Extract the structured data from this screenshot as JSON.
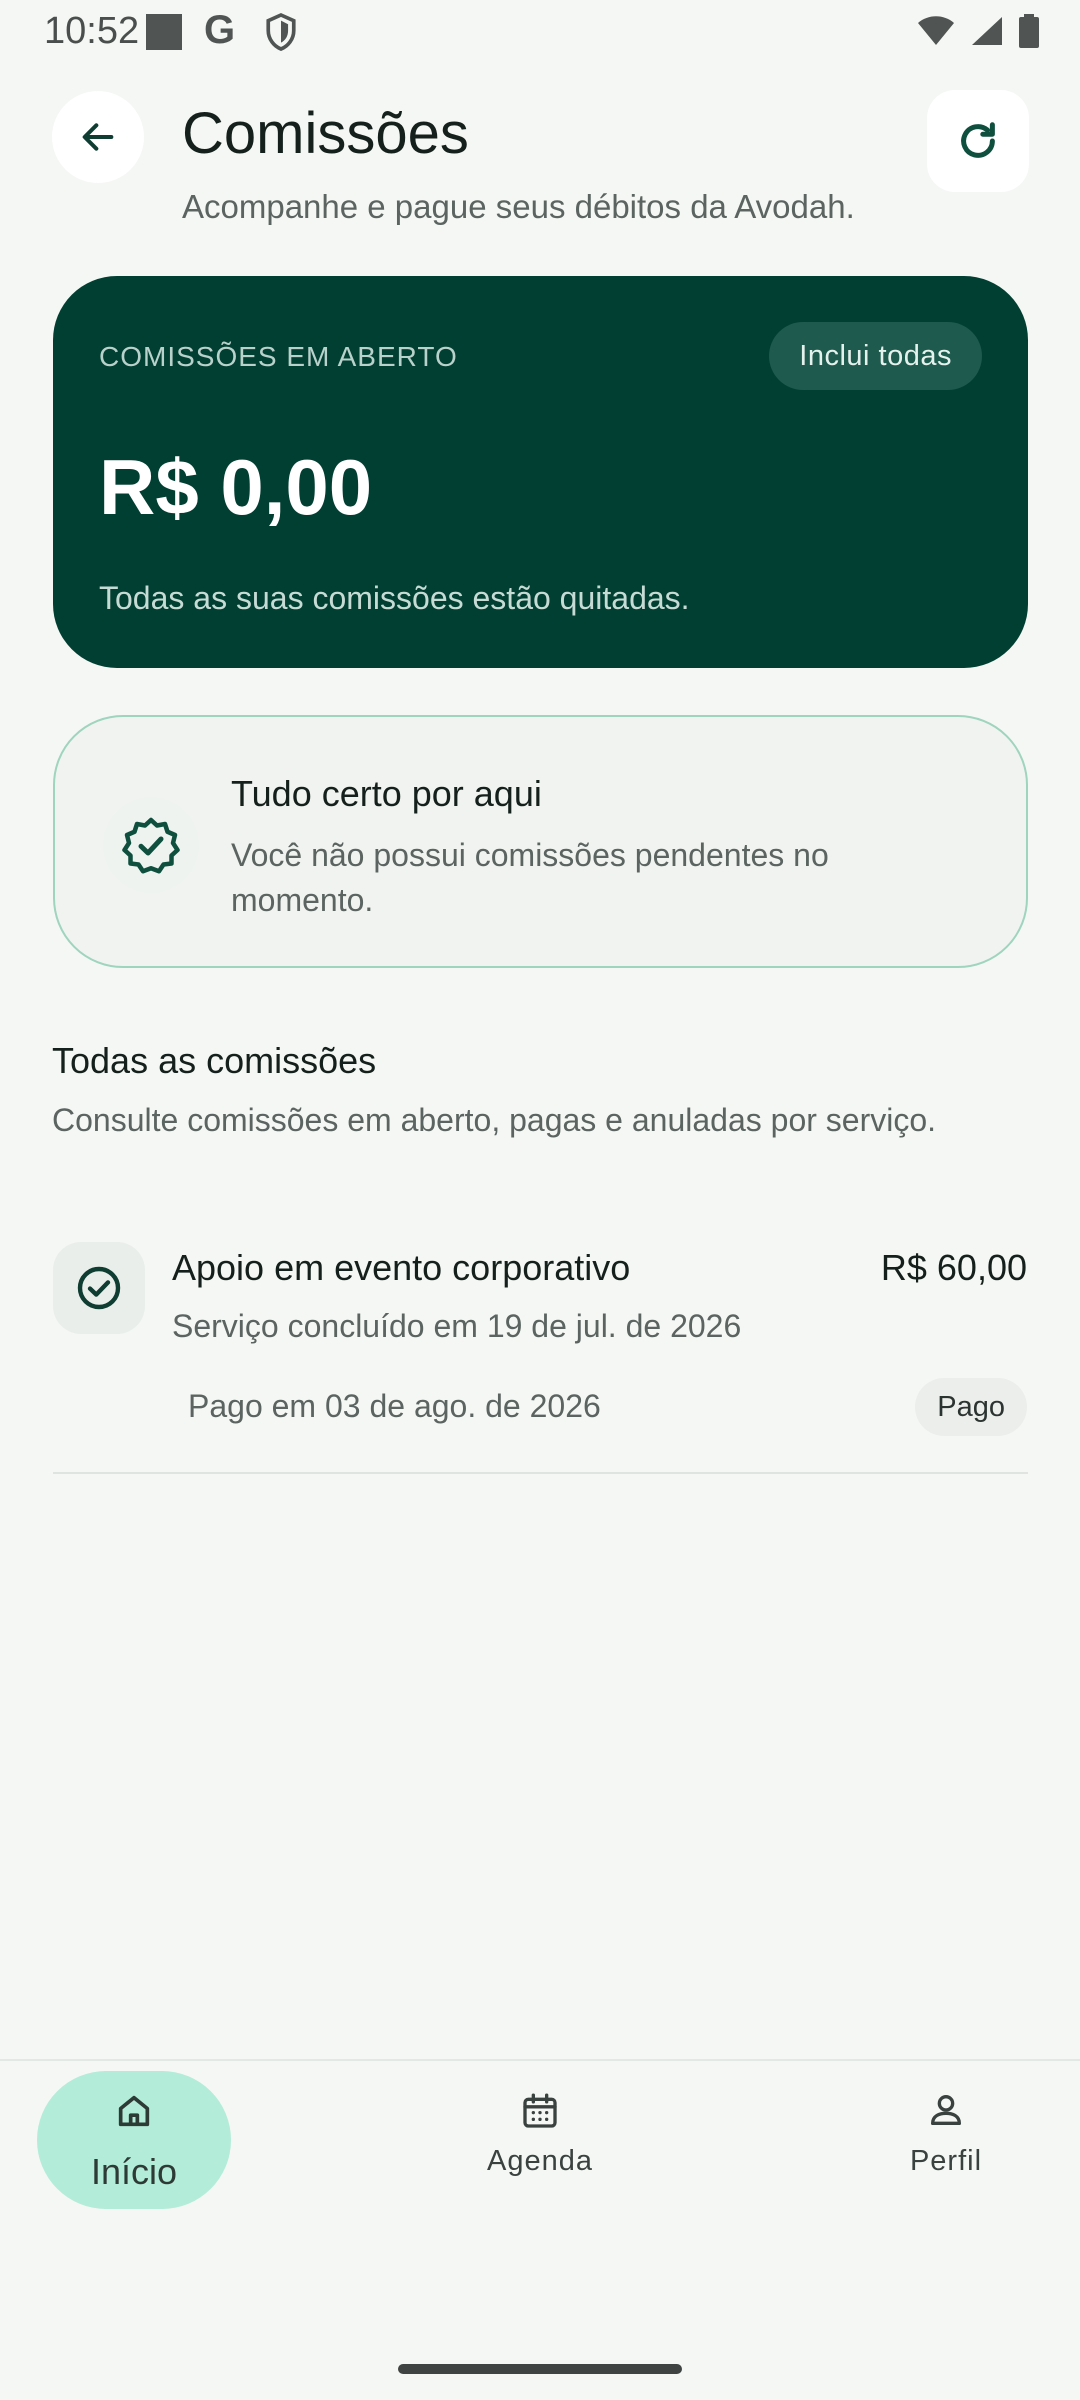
{
  "status_bar": {
    "time": "10:52"
  },
  "header": {
    "title": "Comissões",
    "subtitle": "Acompanhe e pague seus débitos da Avodah."
  },
  "balance_card": {
    "label": "COMISSÕES EM ABERTO",
    "chip_label": "Inclui todas",
    "amount": "R$ 0,00",
    "note": "Todas as suas comissões estão quitadas."
  },
  "status_card": {
    "title": "Tudo certo por aqui",
    "text": "Você não possui comissões pendentes no momento."
  },
  "section": {
    "title": "Todas as comissões",
    "subtitle": "Consulte comissões em aberto, pagas e anuladas por serviço."
  },
  "commissions": [
    {
      "title": "Apoio em evento corporativo",
      "amount": "R$ 60,00",
      "subtitle": "Serviço concluído em 19 de jul. de 2026",
      "paid_date": "Pago em 03 de ago. de 2026",
      "badge": "Pago"
    }
  ],
  "bottom_nav": {
    "items": [
      {
        "label": "Início",
        "icon": "home-icon",
        "active": true
      },
      {
        "label": "Agenda",
        "icon": "calendar-icon",
        "active": false
      },
      {
        "label": "Perfil",
        "icon": "person-icon",
        "active": false
      }
    ]
  },
  "colors": {
    "primary": "#023f33",
    "accent": "#b3ecd9",
    "background": "#f5f7f4"
  }
}
